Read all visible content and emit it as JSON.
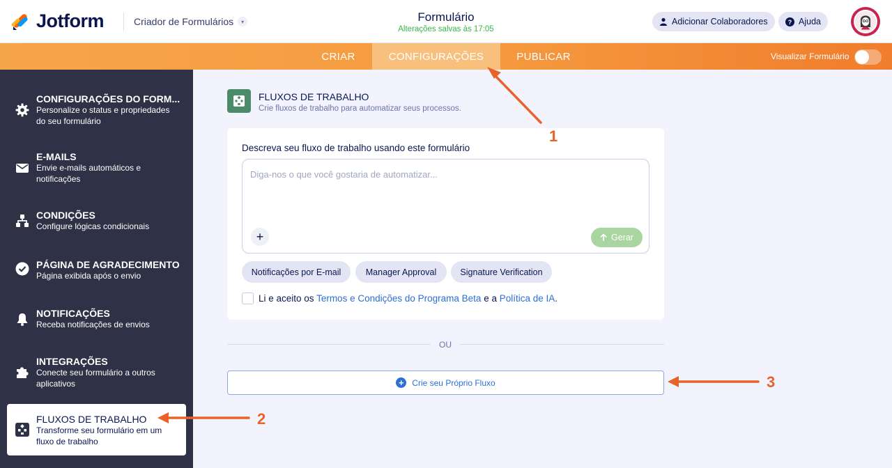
{
  "header": {
    "logo_text": "Jotform",
    "builder_label": "Criador de Formulários",
    "title": "Formulário",
    "status": "Alterações salvas às 17:05",
    "add_collaborators": "Adicionar Colaboradores",
    "help": "Ajuda"
  },
  "nav": {
    "tabs": [
      {
        "label": "CRIAR"
      },
      {
        "label": "CONFIGURAÇÕES"
      },
      {
        "label": "PUBLICAR"
      }
    ],
    "preview_label": "Visualizar Formulário"
  },
  "sidebar": {
    "items": [
      {
        "title": "CONFIGURAÇÕES DO FORM...",
        "desc": "Personalize o status e propriedades do seu formulário",
        "icon": "gear-icon"
      },
      {
        "title": "E-MAILS",
        "desc": "Envie e-mails automáticos e notificações",
        "icon": "envelope-icon"
      },
      {
        "title": "CONDIÇÕES",
        "desc": "Configure lógicas condicionais",
        "icon": "hierarchy-icon"
      },
      {
        "title": "PÁGINA DE AGRADECIMENTO",
        "desc": "Página exibida após o envio",
        "icon": "check-circle-icon"
      },
      {
        "title": "NOTIFICAÇÕES",
        "desc": "Receba notificações de envios",
        "icon": "bell-icon"
      },
      {
        "title": "INTEGRAÇÕES",
        "desc": "Conecte seu formulário a outros aplicativos",
        "icon": "puzzle-icon"
      },
      {
        "title": "FLUXOS DE TRABALHO",
        "desc": "Transforme seu formulário em um fluxo de trabalho",
        "icon": "workflow-icon"
      }
    ]
  },
  "main": {
    "title": "FLUXOS DE TRABALHO",
    "subtitle": "Crie fluxos de trabalho para automatizar seus processos.",
    "card": {
      "label": "Descreva seu fluxo de trabalho usando este formulário",
      "placeholder": "Diga-nos o que você gostaria de automatizar...",
      "generate": "Gerar",
      "chips": [
        "Notificações por E-mail",
        "Manager Approval",
        "Signature Verification"
      ],
      "terms_prefix": "Li e aceito os ",
      "terms_link": "Termos e Condições do Programa Beta",
      "terms_mid": " e a ",
      "policy_link": "Política de IA",
      "terms_suffix": "."
    },
    "or": "OU",
    "own_flow": "Crie seu Próprio Fluxo"
  },
  "annotations": {
    "numbers": [
      "1",
      "2",
      "3"
    ],
    "color": "#e8632b"
  },
  "colors": {
    "accent_orange": "#f59a3f",
    "sidebar_bg": "#2f3246",
    "workflow_green": "#4c8b69",
    "link_blue": "#2c6fd6",
    "status_green": "#39b54a"
  }
}
